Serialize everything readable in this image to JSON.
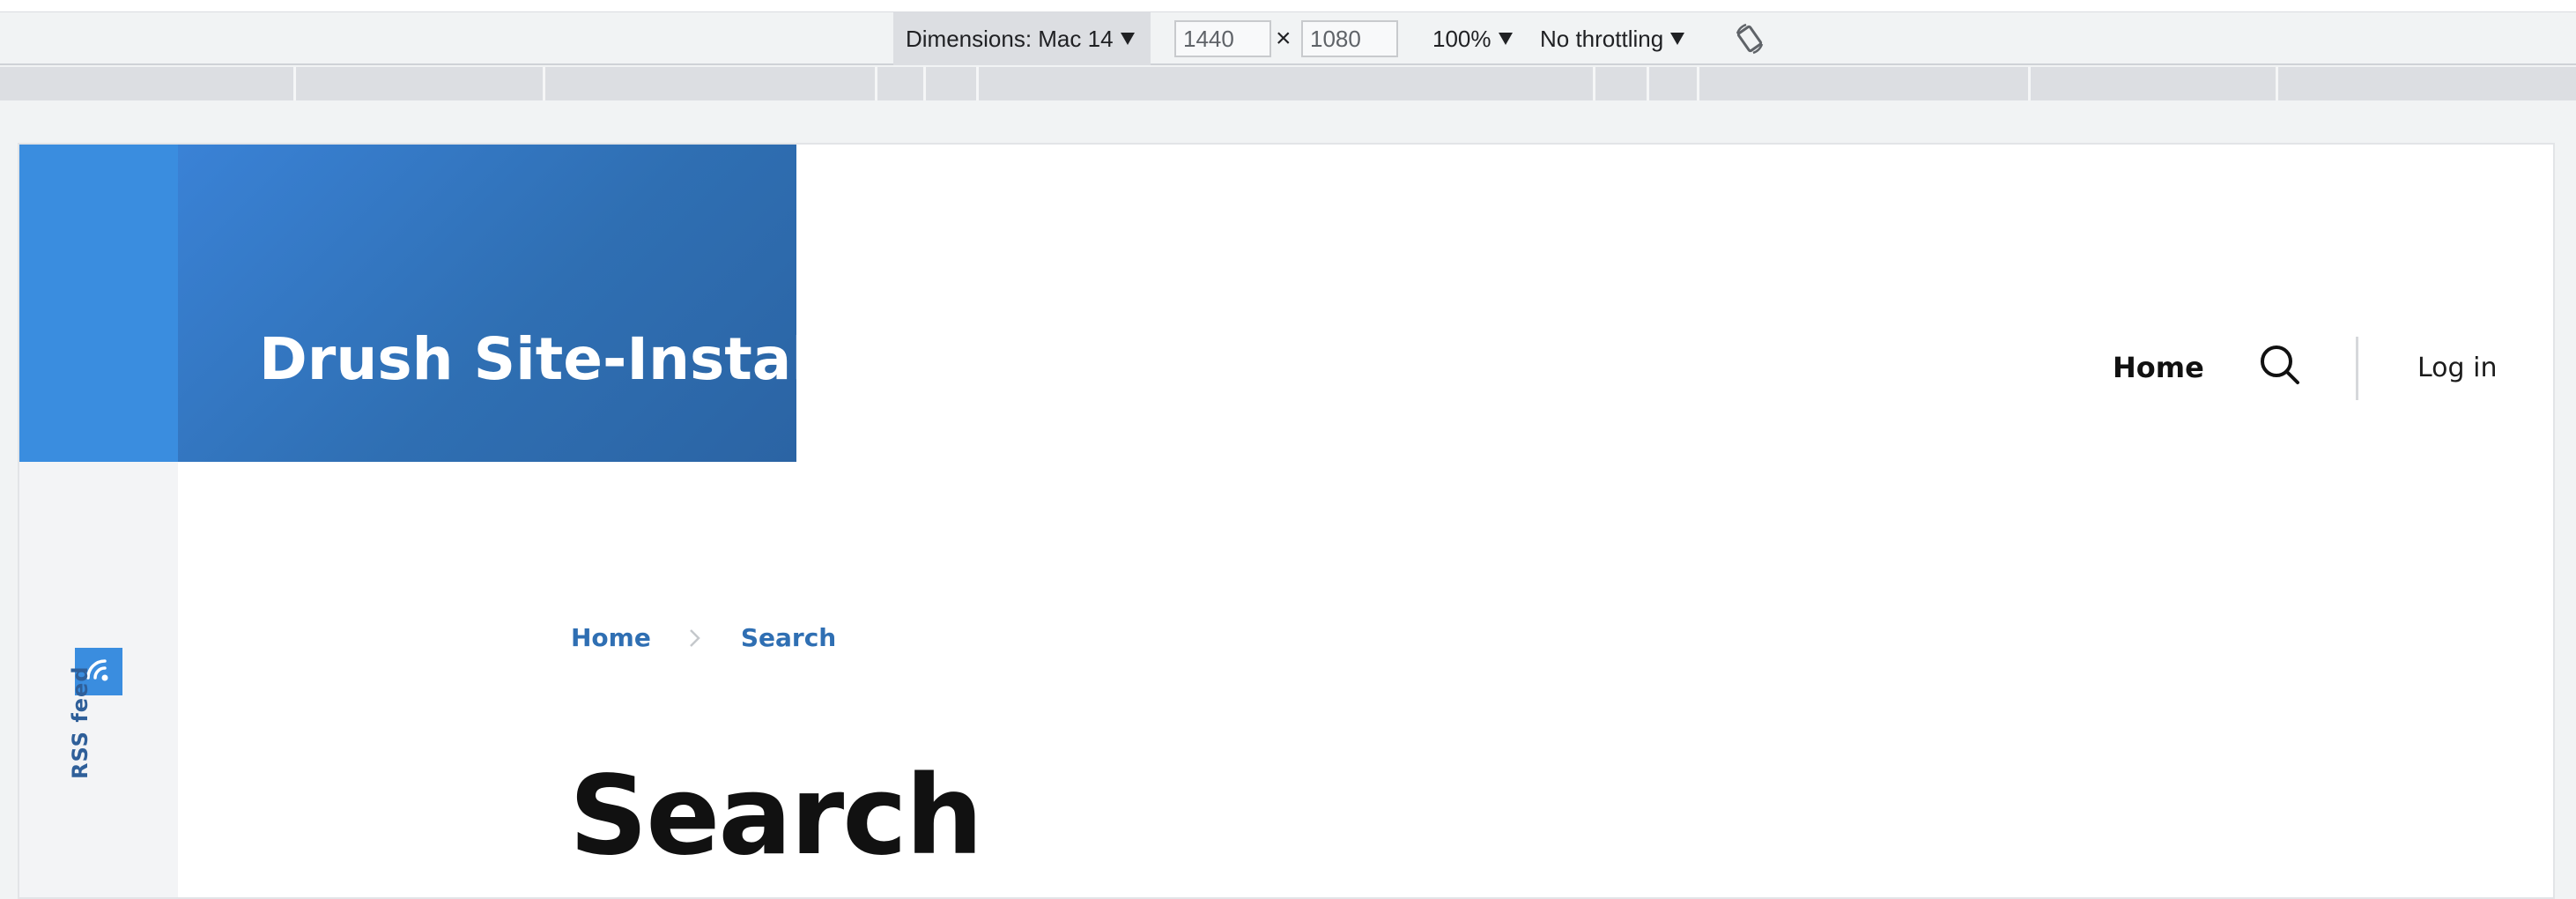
{
  "devtools": {
    "device_label": "Dimensions: Mac 14",
    "width_value": "1440",
    "times_symbol": "×",
    "height_value": "1080",
    "zoom_label": "100%",
    "throttle_label": "No throttling",
    "rotate_icon": "rotate-icon"
  },
  "site": {
    "name": "Drush Site-Install",
    "brand_color": "#2f6fb3",
    "accent_color": "#3a8ddf"
  },
  "nav": {
    "home": "Home",
    "search_icon": "search-icon",
    "login": "Log in"
  },
  "sidebar": {
    "rss_icon": "rss-icon",
    "rss_label": "RSS feed"
  },
  "breadcrumb": {
    "items": [
      "Home",
      "Search"
    ],
    "separator_icon": "chevron-right-icon"
  },
  "page": {
    "title": "Search"
  }
}
